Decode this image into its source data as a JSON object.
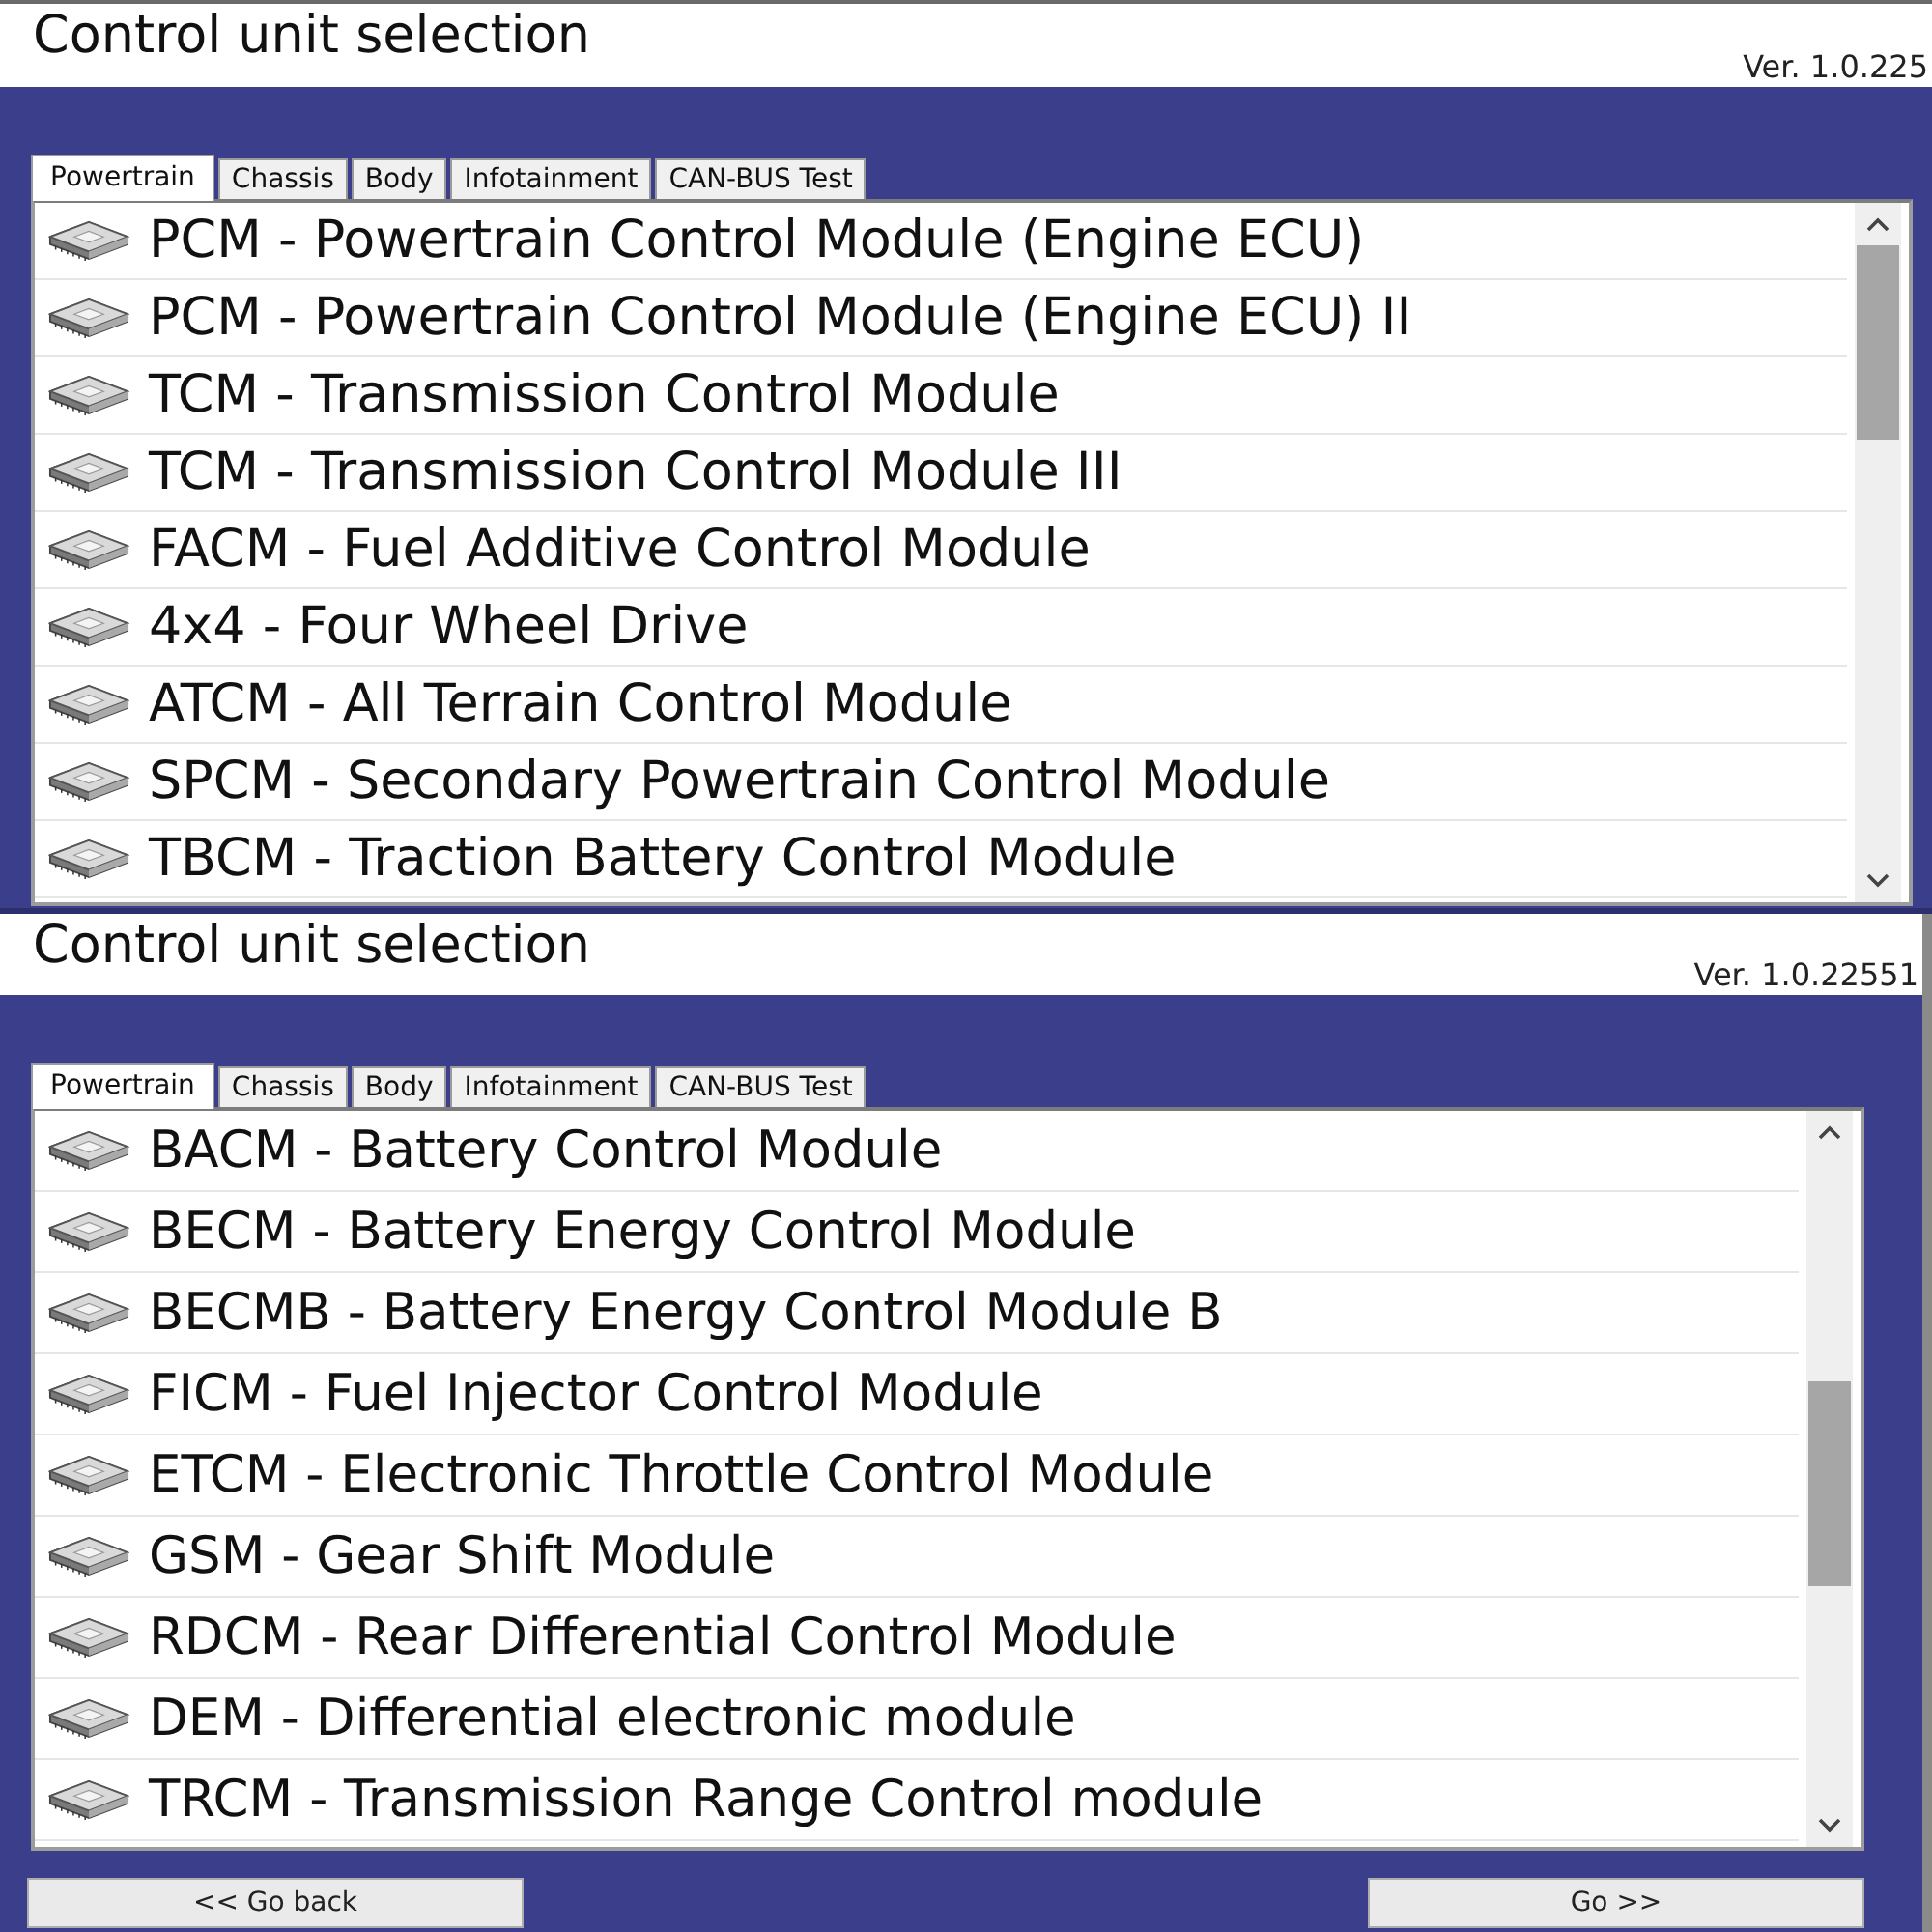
{
  "screens": [
    {
      "title": "Control unit selection",
      "version": "Ver. 1.0.225",
      "tabs": [
        {
          "label": "Powertrain",
          "selected": true
        },
        {
          "label": "Chassis",
          "selected": false
        },
        {
          "label": "Body",
          "selected": false
        },
        {
          "label": "Infotainment",
          "selected": false
        },
        {
          "label": "CAN-BUS Test",
          "selected": false
        }
      ],
      "modules": [
        "PCM - Powertrain Control Module (Engine ECU)",
        "PCM - Powertrain Control Module (Engine ECU) II",
        "TCM - Transmission Control Module",
        "TCM - Transmission Control Module III",
        "FACM - Fuel Additive Control Module",
        "4x4 - Four Wheel Drive",
        "ATCM - All Terrain Control Module",
        "SPCM - Secondary Powertrain Control Module",
        "TBCM - Traction Battery Control Module"
      ]
    },
    {
      "title": "Control unit selection",
      "version": "Ver. 1.0.22551",
      "tabs": [
        {
          "label": "Powertrain",
          "selected": true
        },
        {
          "label": "Chassis",
          "selected": false
        },
        {
          "label": "Body",
          "selected": false
        },
        {
          "label": "Infotainment",
          "selected": false
        },
        {
          "label": "CAN-BUS Test",
          "selected": false
        }
      ],
      "modules": [
        "BACM - Battery Control Module",
        "BECM - Battery Energy Control Module",
        "BECMB - Battery Energy Control Module B",
        "FICM - Fuel Injector Control Module",
        "ETCM - Electronic Throttle Control Module",
        "GSM - Gear Shift Module",
        "RDCM - Rear Differential Control Module",
        "DEM - Differential electronic module",
        "TRCM - Transmission Range Control module"
      ],
      "buttons": [
        "<< Go back",
        "Go >>"
      ]
    }
  ]
}
